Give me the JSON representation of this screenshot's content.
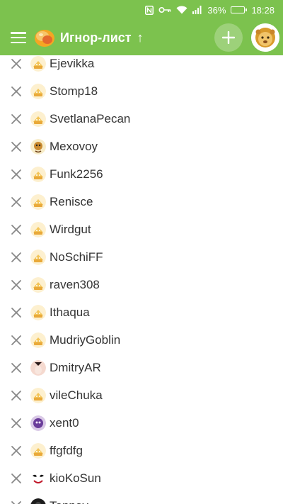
{
  "status_bar": {
    "battery": "36%",
    "time": "18:28",
    "battery_level": 0.36
  },
  "app_bar": {
    "title": "Игнор-лист",
    "sort_icon": "arrow-up-icon",
    "add_icon": "plus-icon",
    "menu_icon": "hamburger-menu-icon",
    "logo_icon": "app-logo-icon",
    "profile_avatar": "lion-avatar"
  },
  "colors": {
    "accent": "#7cc24e",
    "text": "#333333",
    "remove_icon": "#888888"
  },
  "ignore_list": [
    {
      "name": "Ejevikka",
      "avatar": "default"
    },
    {
      "name": "Stomp18",
      "avatar": "default"
    },
    {
      "name": "SvetlanaPecan",
      "avatar": "default"
    },
    {
      "name": "Mexovoy",
      "avatar": "custom-cartoon"
    },
    {
      "name": "Funk2256",
      "avatar": "default"
    },
    {
      "name": "Renisce",
      "avatar": "default"
    },
    {
      "name": "Wirdgut",
      "avatar": "default"
    },
    {
      "name": "NoSchiFF",
      "avatar": "default"
    },
    {
      "name": "raven308",
      "avatar": "default"
    },
    {
      "name": "Ithaqua",
      "avatar": "default"
    },
    {
      "name": "MudriyGoblin",
      "avatar": "default"
    },
    {
      "name": "DmitryAR",
      "avatar": "custom-face"
    },
    {
      "name": "vileChuka",
      "avatar": "default"
    },
    {
      "name": "xent0",
      "avatar": "custom-purple"
    },
    {
      "name": "ffgfdfg",
      "avatar": "default"
    },
    {
      "name": "kioKoSun",
      "avatar": "custom-joker"
    },
    {
      "name": "Tonnay",
      "avatar": "custom-dark"
    }
  ]
}
